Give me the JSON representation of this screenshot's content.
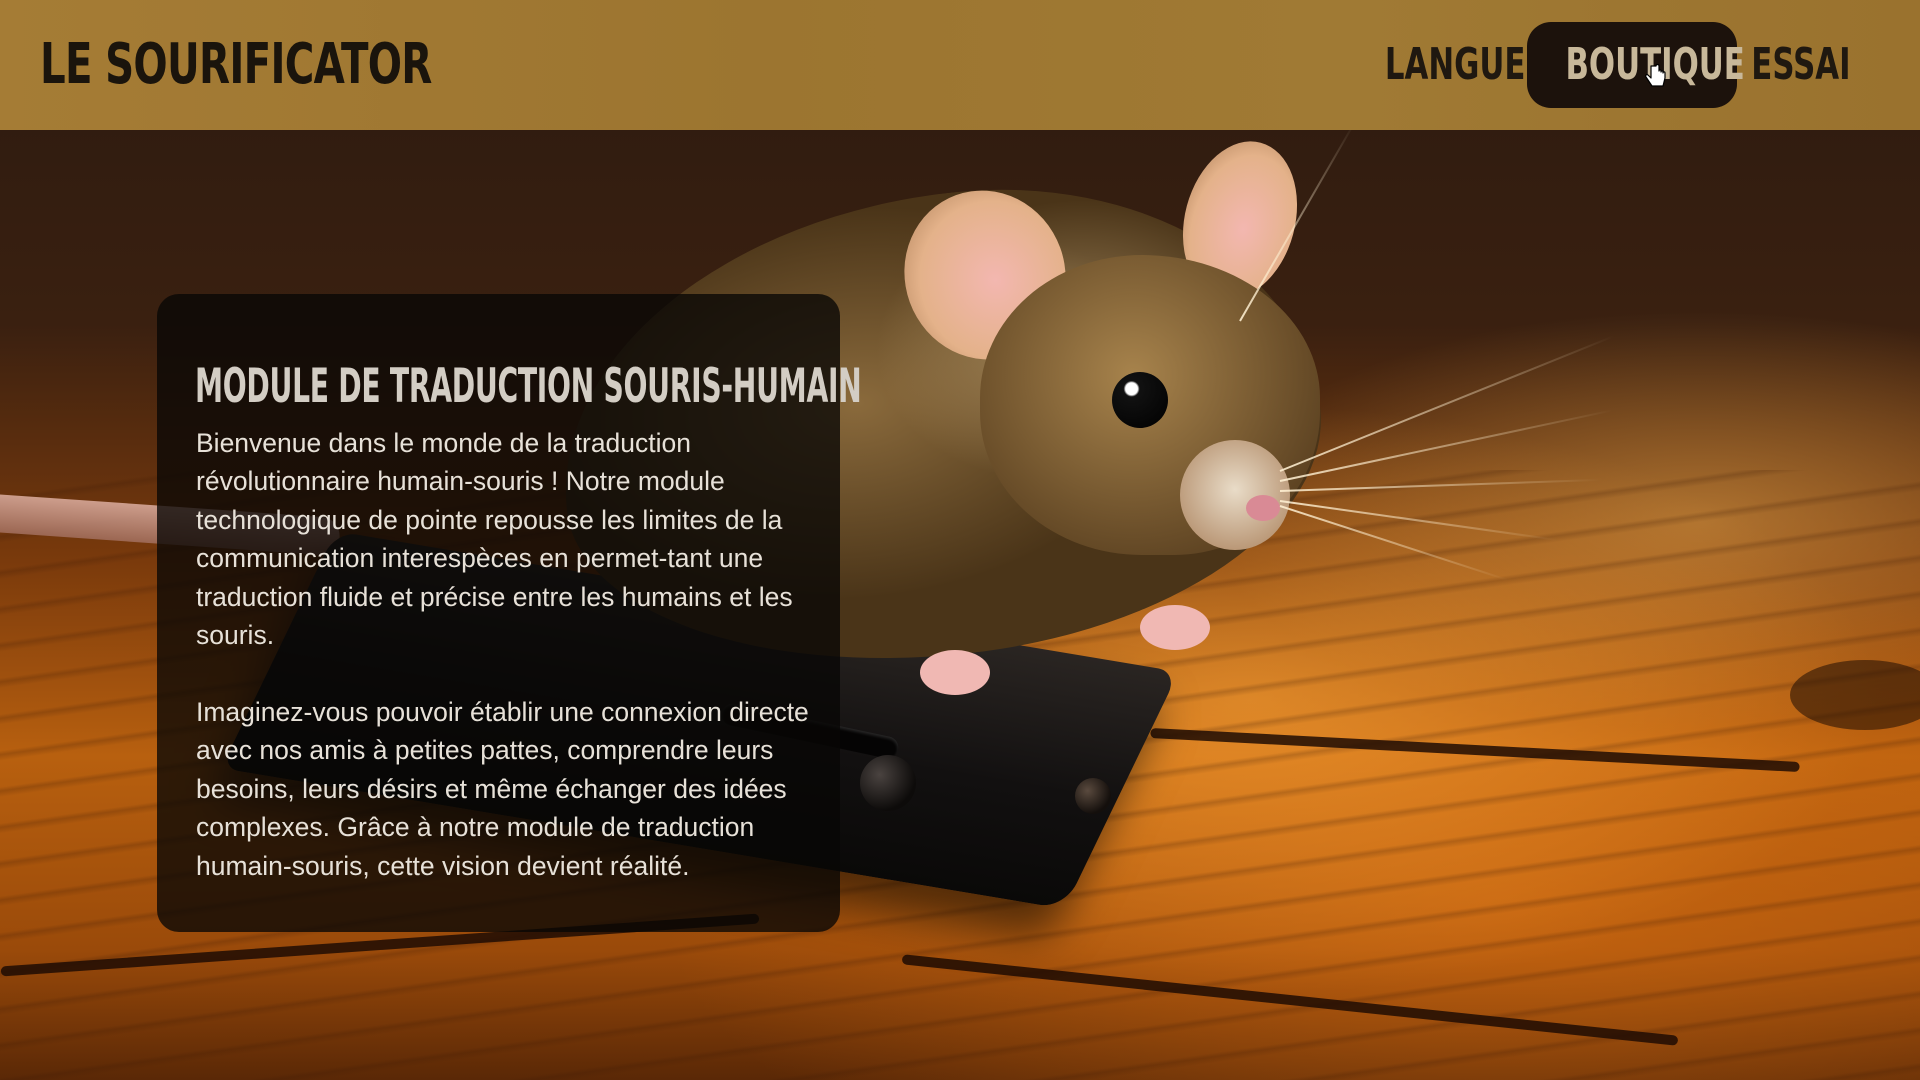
{
  "header": {
    "logo": "LE SOURIFICATOR",
    "nav": [
      {
        "label": "LANGUES",
        "active": false
      },
      {
        "label": "BOUTIQUE",
        "active": true
      },
      {
        "label": "ESSAI",
        "active": false
      }
    ]
  },
  "hero": {
    "image": "mouse-on-device-photo"
  },
  "panel": {
    "title": "MODULE DE TRADUCTION SOURIS-HUMAIN",
    "paragraph_1": "Bienvenue dans le monde de la traduction révolutionnaire humain-souris ! Notre module technologique de pointe repousse les limites de la communication interespèces en permet-tant une traduction fluide et précise entre les humains et les souris.",
    "paragraph_2": "Imaginez-vous pouvoir établir une connexion directe avec nos amis à petites pattes, comprendre leurs besoins, leurs désirs et même échanger des idées complexes. Grâce à notre module de traduction humain-souris, cette vision devient réalité."
  },
  "colors": {
    "header_bg": "#a07a34",
    "active_nav_bg": "#1c120c",
    "panel_bg": "#080605"
  },
  "icons": {
    "cursor": "hand-pointer-icon"
  }
}
